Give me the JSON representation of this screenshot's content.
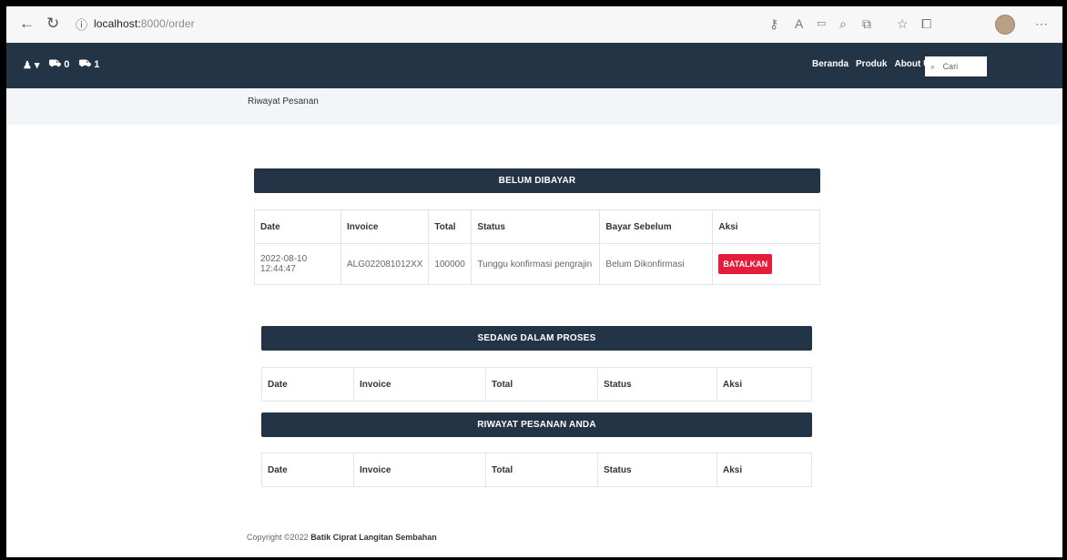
{
  "browser": {
    "url_host": "localhost:",
    "url_path": "8000/order"
  },
  "navbar": {
    "user_label": "▾",
    "cart_count": "0",
    "order_count": "1",
    "links": [
      "Beranda",
      "Produk",
      "About Us"
    ],
    "search_placeholder": "Cari"
  },
  "breadcrumb": "Riwayat Pesanan",
  "unpaid": {
    "title": "BELUM DIBAYAR",
    "headers": [
      "Date",
      "Invoice",
      "Total",
      "Status",
      "Bayar Sebelum",
      "Aksi"
    ],
    "rows": [
      {
        "date": "2022-08-10 12:44:47",
        "invoice": "ALG022081012XX",
        "total": "100000",
        "status": "Tunggu konfirmasi pengrajin",
        "pay_before": "Belum Dikonfirmasi",
        "action": "BATALKAN"
      }
    ]
  },
  "in_process": {
    "title": "SEDANG DALAM PROSES",
    "headers": [
      "Date",
      "Invoice",
      "Total",
      "Status",
      "Aksi"
    ]
  },
  "history": {
    "title": "RIWAYAT PESANAN ANDA",
    "headers": [
      "Date",
      "Invoice",
      "Total",
      "Status",
      "Aksi"
    ]
  },
  "footer": {
    "prefix": "Copyright ©2022",
    "brand": "Batik Ciprat Langitan Sembahan"
  },
  "colors": {
    "navbar": "#243447",
    "cancel_button": "#e51c3a"
  }
}
